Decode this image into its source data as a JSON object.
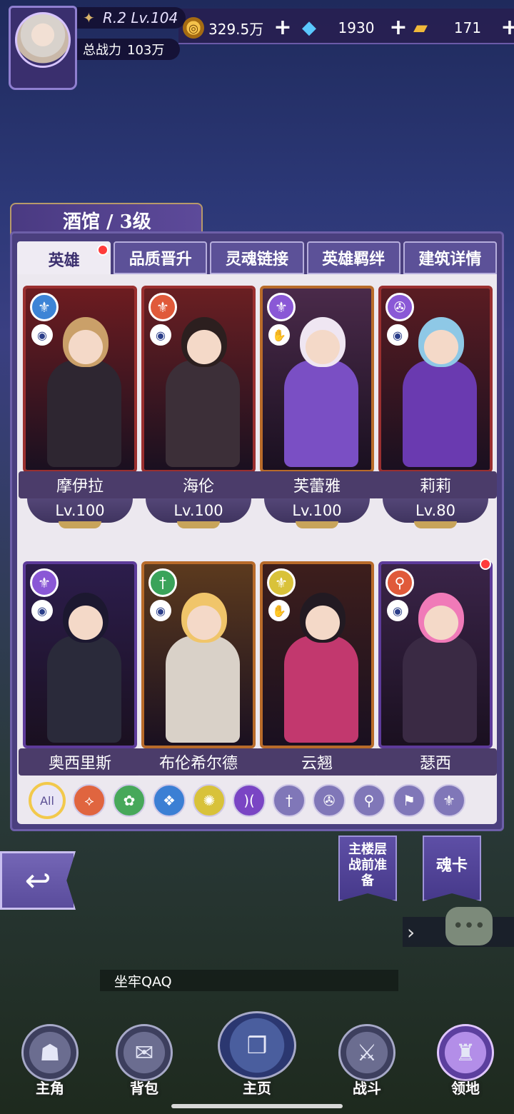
{
  "player": {
    "rank": "R.2 Lv.104",
    "power_label": "总战力",
    "power_value": "103万"
  },
  "currencies": [
    {
      "icon": "gold-coin-icon",
      "value": "329.5万",
      "plus": "+"
    },
    {
      "icon": "diamond-icon",
      "value": "1930",
      "plus": "+"
    },
    {
      "icon": "ticket-icon",
      "value": "171",
      "plus": "+"
    }
  ],
  "tavern": {
    "title": "酒馆 / 3级",
    "tabs": [
      {
        "label": "英雄",
        "active": true,
        "badge": true
      },
      {
        "label": "品质晋升"
      },
      {
        "label": "灵魂链接"
      },
      {
        "label": "英雄羁绊"
      },
      {
        "label": "建筑详情"
      }
    ]
  },
  "heroes": [
    {
      "name": "摩伊拉",
      "level": "Lv.100",
      "element_icon": "wings-icon",
      "element_color": "#3d84d6",
      "class_icon": "eye-icon",
      "frame": "#9a2f2f",
      "bg": "#6d1c20",
      "hair": "#caa069",
      "outfit": "#2e2631"
    },
    {
      "name": "海伦",
      "level": "Lv.100",
      "element_icon": "wings-icon",
      "element_color": "#e05a3a",
      "class_icon": "eye-icon",
      "frame": "#9a2f2f",
      "bg": "#6a1f22",
      "hair": "#2c1f1f",
      "outfit": "#3c2f38"
    },
    {
      "name": "芙蕾雅",
      "level": "Lv.100",
      "element_icon": "wings-icon",
      "element_color": "#8a58d6",
      "class_icon": "hand-icon",
      "frame": "#b86b2a",
      "bg": "#4a2a4a",
      "hair": "#efe6f2",
      "outfit": "#7a4fc4"
    },
    {
      "name": "莉莉",
      "level": "Lv.80",
      "element_icon": "swirl-icon",
      "element_color": "#8a58d6",
      "class_icon": "eye-icon",
      "frame": "#9a2f2f",
      "bg": "#5a1c22",
      "hair": "#8ec8e6",
      "outfit": "#6a3ab0"
    },
    {
      "name": "奥西里斯",
      "level": "",
      "element_icon": "wings-icon",
      "element_color": "#8a58d6",
      "class_icon": "eye-icon",
      "frame": "#5d3b9a",
      "bg": "#2c1d4c",
      "hair": "#1c1830",
      "outfit": "#2a2a3a"
    },
    {
      "name": "布伦希尔德",
      "level": "",
      "element_icon": "dagger-icon",
      "element_color": "#3aa35a",
      "class_icon": "eye-icon",
      "frame": "#b86b2a",
      "bg": "#5c3a1e",
      "hair": "#f0c56a",
      "outfit": "#d9d1c8"
    },
    {
      "name": "云翘",
      "level": "",
      "element_icon": "wings-icon",
      "element_color": "#d9c23a",
      "class_icon": "hand-icon",
      "frame": "#b86b2a",
      "bg": "#3d1e1c",
      "hair": "#221a22",
      "outfit": "#c2386e"
    },
    {
      "name": "瑟西",
      "level": "",
      "element_icon": "magnifier-icon",
      "element_color": "#e05a3a",
      "class_icon": "eye-icon",
      "frame": "#5d3b9a",
      "bg": "#3a2448",
      "hair": "#f07ab8",
      "outfit": "#3a2a44",
      "badge": true
    }
  ],
  "filters": [
    {
      "label": "All",
      "icon": "all-icon",
      "color": "#e9e6f6"
    },
    {
      "icon": "fire-element-icon",
      "color": "#e0653f",
      "glyph": "⟡"
    },
    {
      "icon": "wind-element-icon",
      "color": "#47a85a",
      "glyph": "✿"
    },
    {
      "icon": "water-element-icon",
      "color": "#3b7fd4",
      "glyph": "❖"
    },
    {
      "icon": "light-element-icon",
      "color": "#d8c23a",
      "glyph": "✺"
    },
    {
      "icon": "dark-element-icon",
      "color": "#7a45c4",
      "glyph": ")("
    },
    {
      "icon": "dagger-class-icon",
      "color": "#8077b8",
      "glyph": "†"
    },
    {
      "icon": "swirl-class-icon",
      "color": "#8077b8",
      "glyph": "✇"
    },
    {
      "icon": "magnifier-class-icon",
      "color": "#8077b8",
      "glyph": "⚲"
    },
    {
      "icon": "flag-class-icon",
      "color": "#8077b8",
      "glyph": "⚑"
    },
    {
      "icon": "wings-class-icon",
      "color": "#8077b8",
      "glyph": "⚜"
    }
  ],
  "side_buttons": {
    "back": "back-arrow-icon",
    "prepare": "主楼层战前准备",
    "soul_card": "魂卡"
  },
  "chat": {
    "message": "坐牢QAQ"
  },
  "nav": [
    {
      "label": "主角",
      "icon": "hero-icon"
    },
    {
      "label": "背包",
      "icon": "bag-icon"
    },
    {
      "label": "主页",
      "icon": "book-icon"
    },
    {
      "label": "战斗",
      "icon": "swords-icon"
    },
    {
      "label": "领地",
      "icon": "castle-icon"
    }
  ]
}
